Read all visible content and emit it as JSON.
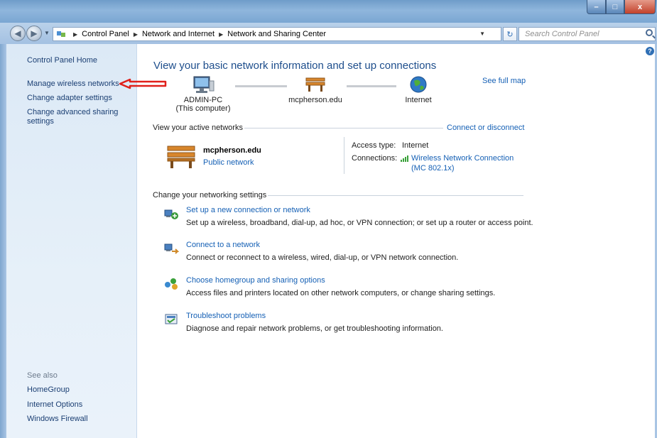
{
  "window": {
    "controls": {
      "minimize": "–",
      "maximize": "□",
      "close": "x"
    }
  },
  "address": {
    "crumbs": [
      "Control Panel",
      "Network and Internet",
      "Network and Sharing Center"
    ],
    "search_placeholder": "Search Control Panel"
  },
  "sidebar": {
    "home": "Control Panel Home",
    "links": [
      "Manage wireless networks",
      "Change adapter settings",
      "Change advanced sharing settings"
    ],
    "see_also_label": "See also",
    "see_also": [
      "HomeGroup",
      "Internet Options",
      "Windows Firewall"
    ]
  },
  "main": {
    "title": "View your basic network information and set up connections",
    "see_full_map": "See full map",
    "map": {
      "computer_name": "ADMIN-PC",
      "computer_sub": "(This computer)",
      "network_name": "mcpherson.edu",
      "internet": "Internet"
    },
    "active_networks": {
      "heading": "View your active networks",
      "connect_link": "Connect or disconnect",
      "network_name": "mcpherson.edu",
      "network_type": "Public network",
      "access_type_label": "Access type:",
      "access_type_value": "Internet",
      "connections_label": "Connections:",
      "connection_name": "Wireless Network Connection",
      "connection_sub": "(MC 802.1x)"
    },
    "change_settings": {
      "heading": "Change your networking settings",
      "tasks": [
        {
          "title": "Set up a new connection or network",
          "desc": "Set up a wireless, broadband, dial-up, ad hoc, or VPN connection; or set up a router or access point.",
          "icon": "new-connection-icon"
        },
        {
          "title": "Connect to a network",
          "desc": "Connect or reconnect to a wireless, wired, dial-up, or VPN network connection.",
          "icon": "connect-network-icon"
        },
        {
          "title": "Choose homegroup and sharing options",
          "desc": "Access files and printers located on other network computers, or change sharing settings.",
          "icon": "homegroup-icon"
        },
        {
          "title": "Troubleshoot problems",
          "desc": "Diagnose and repair network problems, or get troubleshooting information.",
          "icon": "troubleshoot-icon"
        }
      ]
    }
  },
  "colors": {
    "link": "#1560b5",
    "title": "#1e4e8c",
    "sidebar_link": "#1b3f73",
    "annotation_arrow": "#e0201b"
  }
}
